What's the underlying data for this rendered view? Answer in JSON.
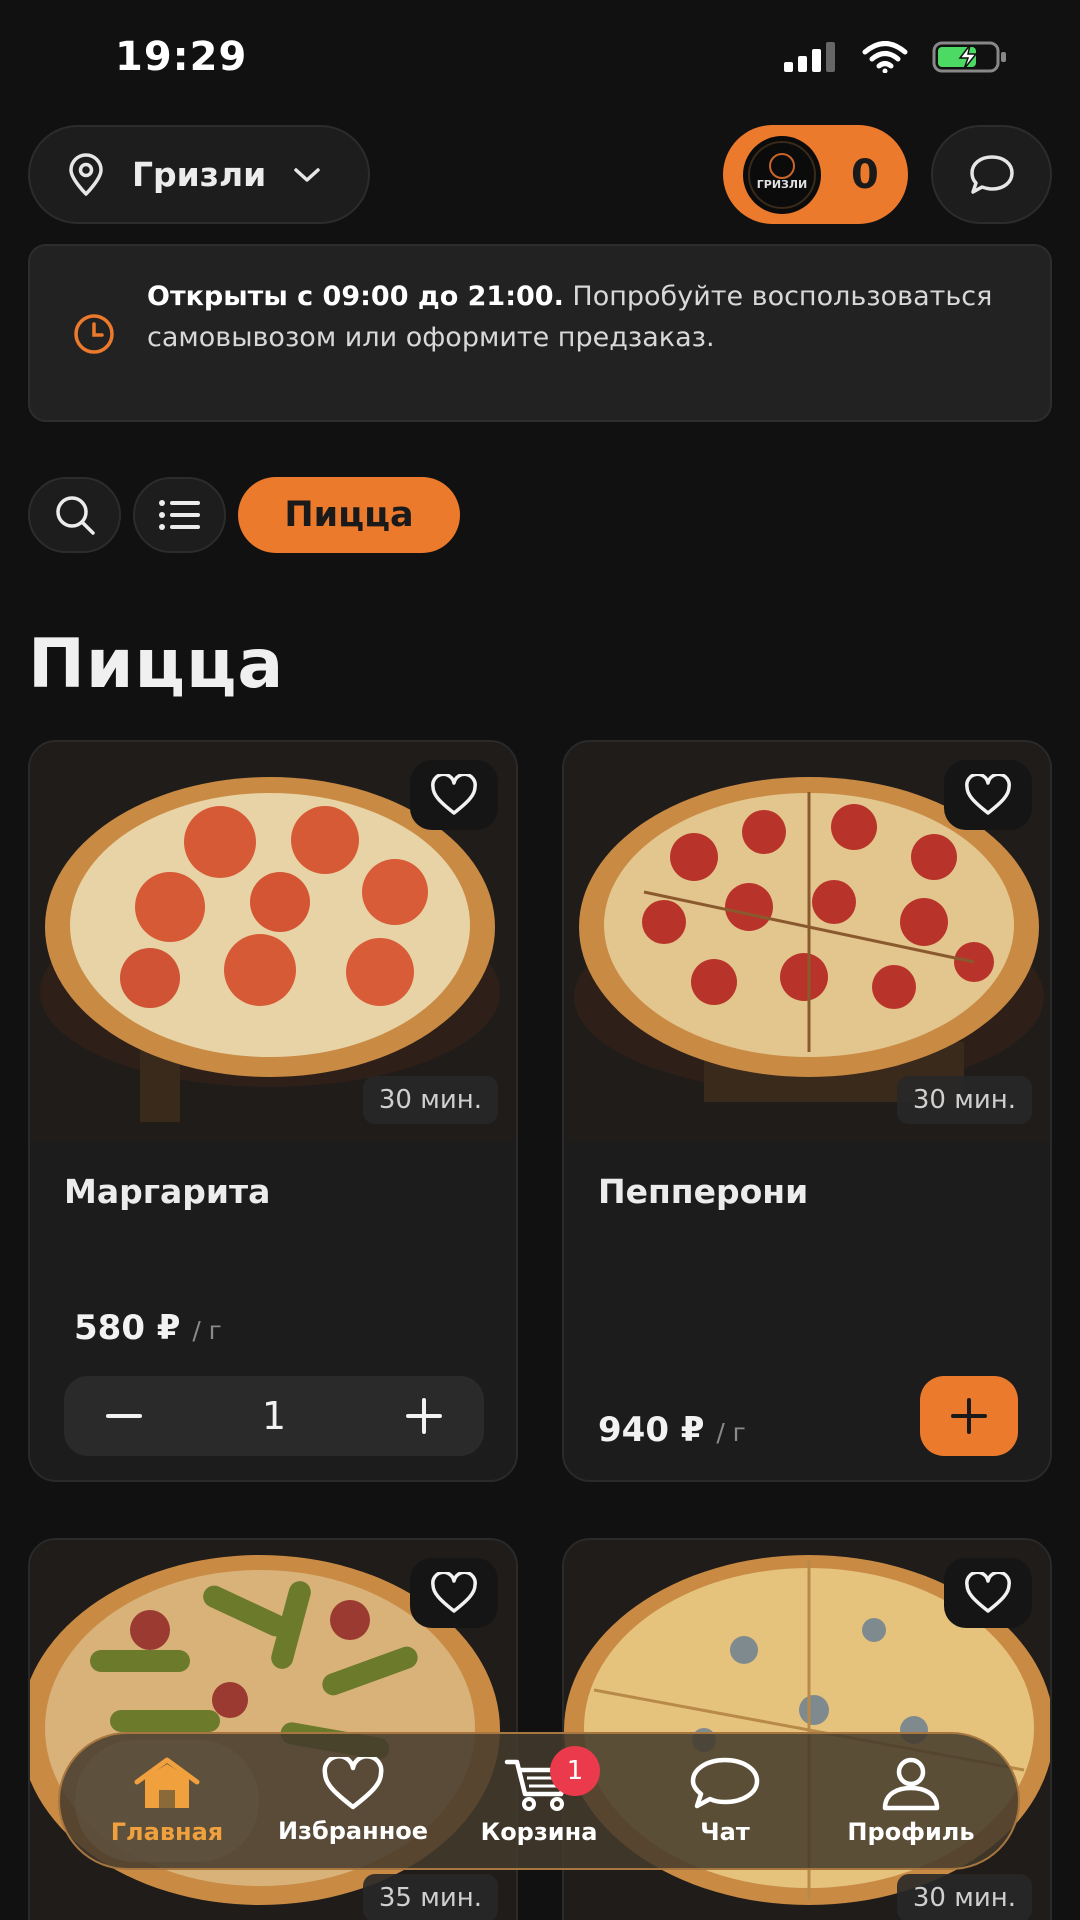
{
  "status_bar": {
    "time": "19:29"
  },
  "header": {
    "location_label": "Гризли",
    "bonus_logo_text": "ГРИЗЛИ",
    "bonus_count": "0"
  },
  "notice": {
    "bold_text": "Открыты с 09:00 до 21:00.",
    "rest_text": " Попробуйте воспользоваться самовывозом или оформите предзаказ."
  },
  "filters": {
    "active_chip": "Пицца"
  },
  "section": {
    "title": "Пицца"
  },
  "products": [
    {
      "name": "Маргарита",
      "time": "30 мин.",
      "price": "580 ₽",
      "unit": "/ г",
      "quantity": "1"
    },
    {
      "name": "Пепперони",
      "time": "30 мин.",
      "price": "940 ₽",
      "unit": "/ г"
    },
    {
      "time": "35 мин."
    },
    {
      "time": "30 мин."
    }
  ],
  "tabbar": {
    "items": [
      {
        "label": "Главная",
        "icon": "home-icon",
        "active": true
      },
      {
        "label": "Избранное",
        "icon": "heart-icon"
      },
      {
        "label": "Корзина",
        "icon": "cart-icon",
        "badge": "1"
      },
      {
        "label": "Чат",
        "icon": "chat-icon"
      },
      {
        "label": "Профиль",
        "icon": "profile-icon"
      }
    ]
  },
  "colors": {
    "accent": "#ec7a2d",
    "background": "#111111",
    "card": "#1c1c1c",
    "badge": "#ea3a4c"
  }
}
